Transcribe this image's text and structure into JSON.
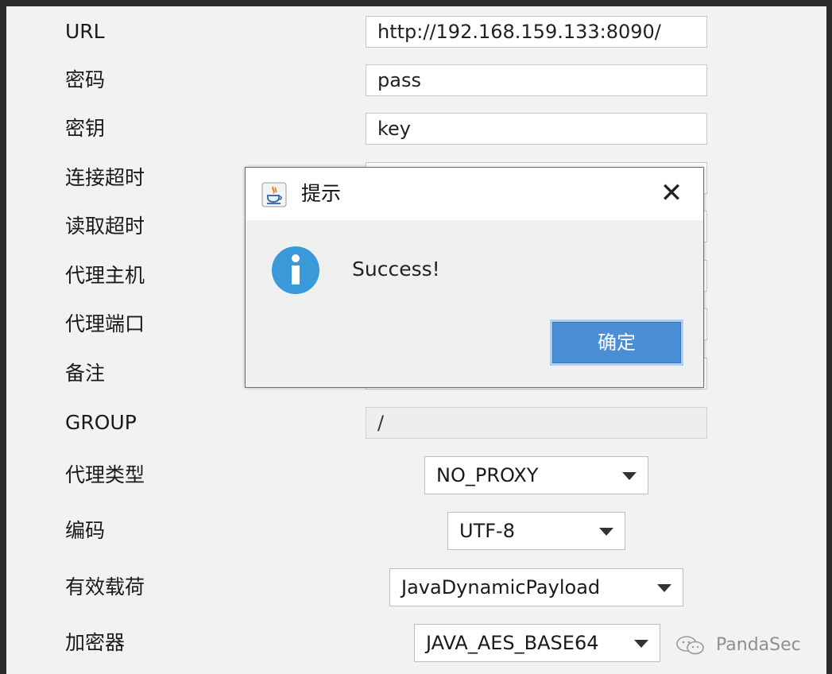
{
  "form": {
    "url_label": "URL",
    "url_value": "http://192.168.159.133:8090/",
    "password_label": "密码",
    "password_value": "pass",
    "key_label": "密钥",
    "key_value": "key",
    "connect_timeout_label": "连接超时",
    "read_timeout_label": "读取超时",
    "proxy_host_label": "代理主机",
    "proxy_port_label": "代理端口",
    "remark_label": "备注",
    "group_label": "GROUP",
    "group_value": "/",
    "proxy_type_label": "代理类型",
    "proxy_type_value": "NO_PROXY",
    "encoding_label": "编码",
    "encoding_value": "UTF-8",
    "payload_label": "有效载荷",
    "payload_value": "JavaDynamicPayload",
    "cryption_label": "加密器",
    "cryption_value": "JAVA_AES_BASE64"
  },
  "dialog": {
    "title": "提示",
    "close_glyph": "✕",
    "message": "Success!",
    "ok_label": "确定"
  },
  "watermark": {
    "text": "PandaSec"
  },
  "colors": {
    "panel_bg": "#f2f2f2",
    "frame_bg": "#2b2b2b",
    "button_blue": "#4a8fd6",
    "info_blue": "#3a9ad9"
  },
  "icons": {
    "dialog_app": "java-icon",
    "message_type": "info-icon",
    "watermark": "wechat-icon"
  }
}
